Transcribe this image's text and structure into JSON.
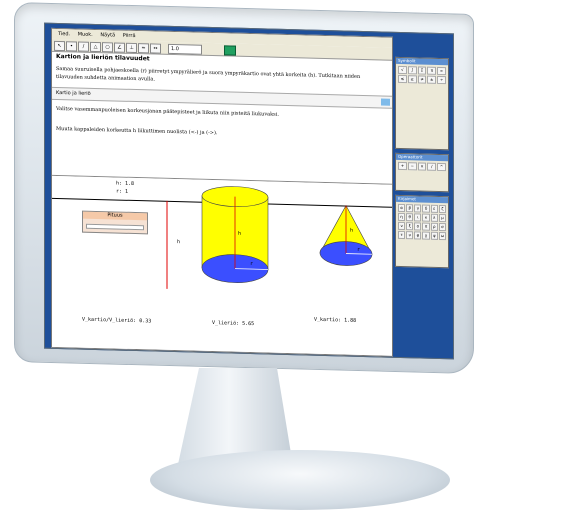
{
  "menubar": {
    "items": [
      "Tied.",
      "Muok.",
      "Näytä",
      "Piirrä"
    ]
  },
  "toolbar": {
    "zoom_value": "1.0",
    "tools": [
      "arrow-tool",
      "point-tool",
      "line-tool",
      "polygon-tool",
      "circle-tool",
      "angle-tool",
      "transform-tool",
      "slider-tool"
    ]
  },
  "document": {
    "title": "Kartion ja lieriön tilavuudet",
    "intro": "Samaa suuruisella pohjaeskoella (r) piirretyt ympyrälierö ja suora ympyräkartio ovat yhtä korkeita (h). Tutkitaan niiden tilavuuden suhdetta animaation avulla.",
    "section_title": "Kartio ja lieriö",
    "instruction1": "Valitse vasemmanpuoleisen korkeusjanan päätepisteet ja liikuta niin pisteitä liukuvaksi.",
    "instruction2": "Muuta kappaleiden korkeutta h liikuttimen nuolista (<-) ja (->)."
  },
  "geometry": {
    "h_label": "h: 1.8",
    "r_label": "r: 1",
    "slider_label": "Pituus",
    "ratio_label": "V_kartio/V_lieriö: 0.33",
    "cyl_label": "V_lieriö: 5.65",
    "cone_label": "V_kartio: 1.88",
    "h_mark": "h",
    "r_mark": "r",
    "colors": {
      "solid": "#ffff00",
      "base": "#3b4fff",
      "axis": "#e00000"
    }
  },
  "side_panels": {
    "panel1_title": "Symbolit",
    "panel2_title": "Operaattorit",
    "panel3_title": "Kirjaimet",
    "letters": [
      "α",
      "β",
      "γ",
      "δ",
      "ε",
      "ζ",
      "η",
      "θ",
      "ι",
      "κ",
      "λ",
      "μ",
      "ν",
      "ξ",
      "ο",
      "π",
      "ρ",
      "σ",
      "τ",
      "υ",
      "φ",
      "χ",
      "ψ",
      "ω"
    ]
  }
}
